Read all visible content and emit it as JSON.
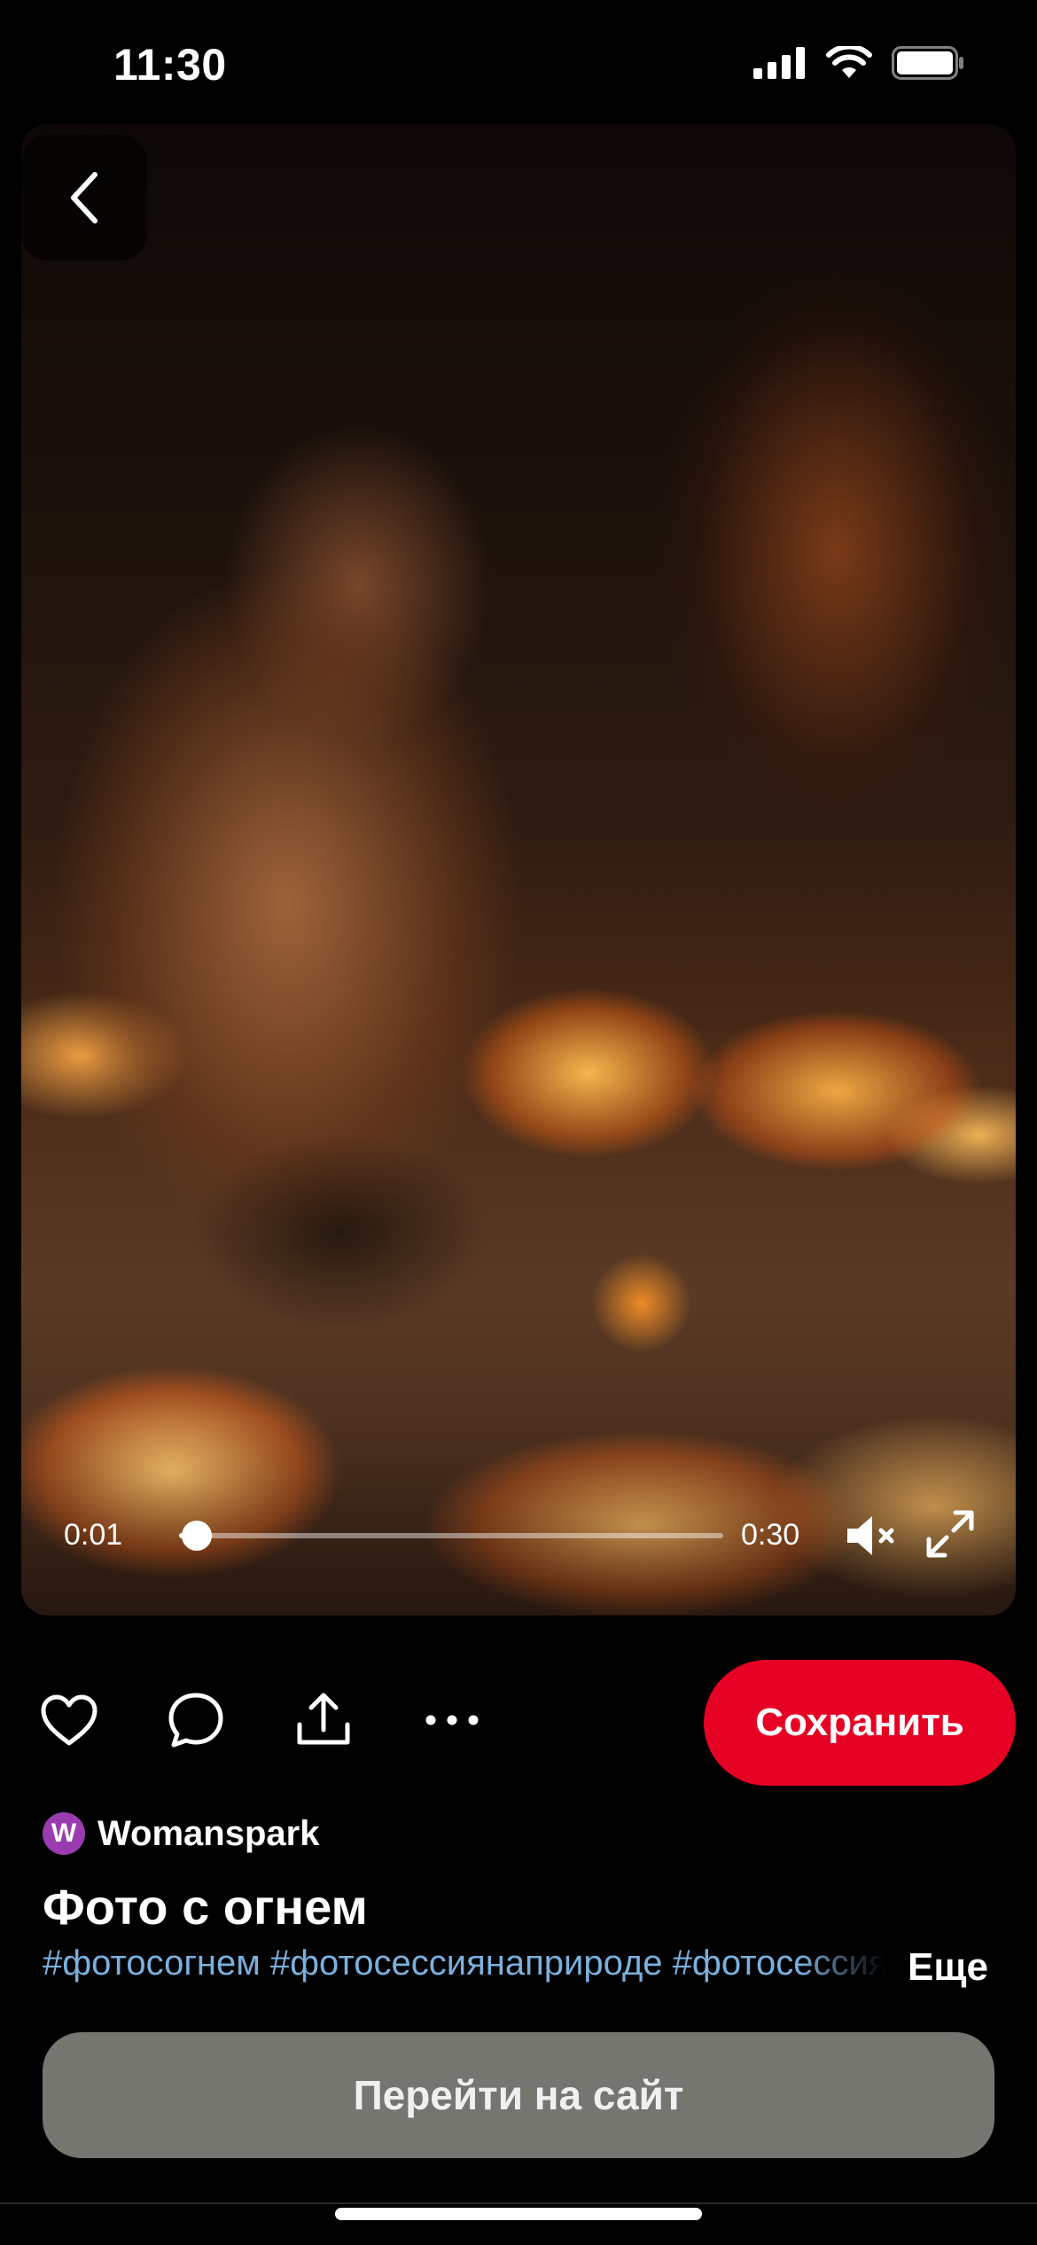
{
  "status_bar": {
    "time": "11:30",
    "icons": [
      "cellular-signal-icon",
      "wifi-icon",
      "battery-icon"
    ]
  },
  "media": {
    "back_icon": "chevron-left-icon",
    "player": {
      "current_time": "0:01",
      "total_time": "0:30",
      "progress_fraction": 0.02,
      "mute_icon": "speaker-muted-icon",
      "fullscreen_icon": "expand-icon"
    }
  },
  "actions": {
    "icons": [
      "heart-icon",
      "comment-icon",
      "share-icon",
      "more-icon"
    ],
    "save_label": "Сохранить"
  },
  "pin": {
    "author_initial": "W",
    "author_name": "Womanspark",
    "title": "Фото с огнем",
    "hashtags": "#фотосогнем #фотосессиянаприроде #фотосессия",
    "more_label": "Еще",
    "visit_label": "Перейти на сайт"
  },
  "colors": {
    "save_button": "#e60023",
    "hashtag": "#7ab0de",
    "visit_button": "#767671",
    "avatar": "#9b3bb0"
  }
}
